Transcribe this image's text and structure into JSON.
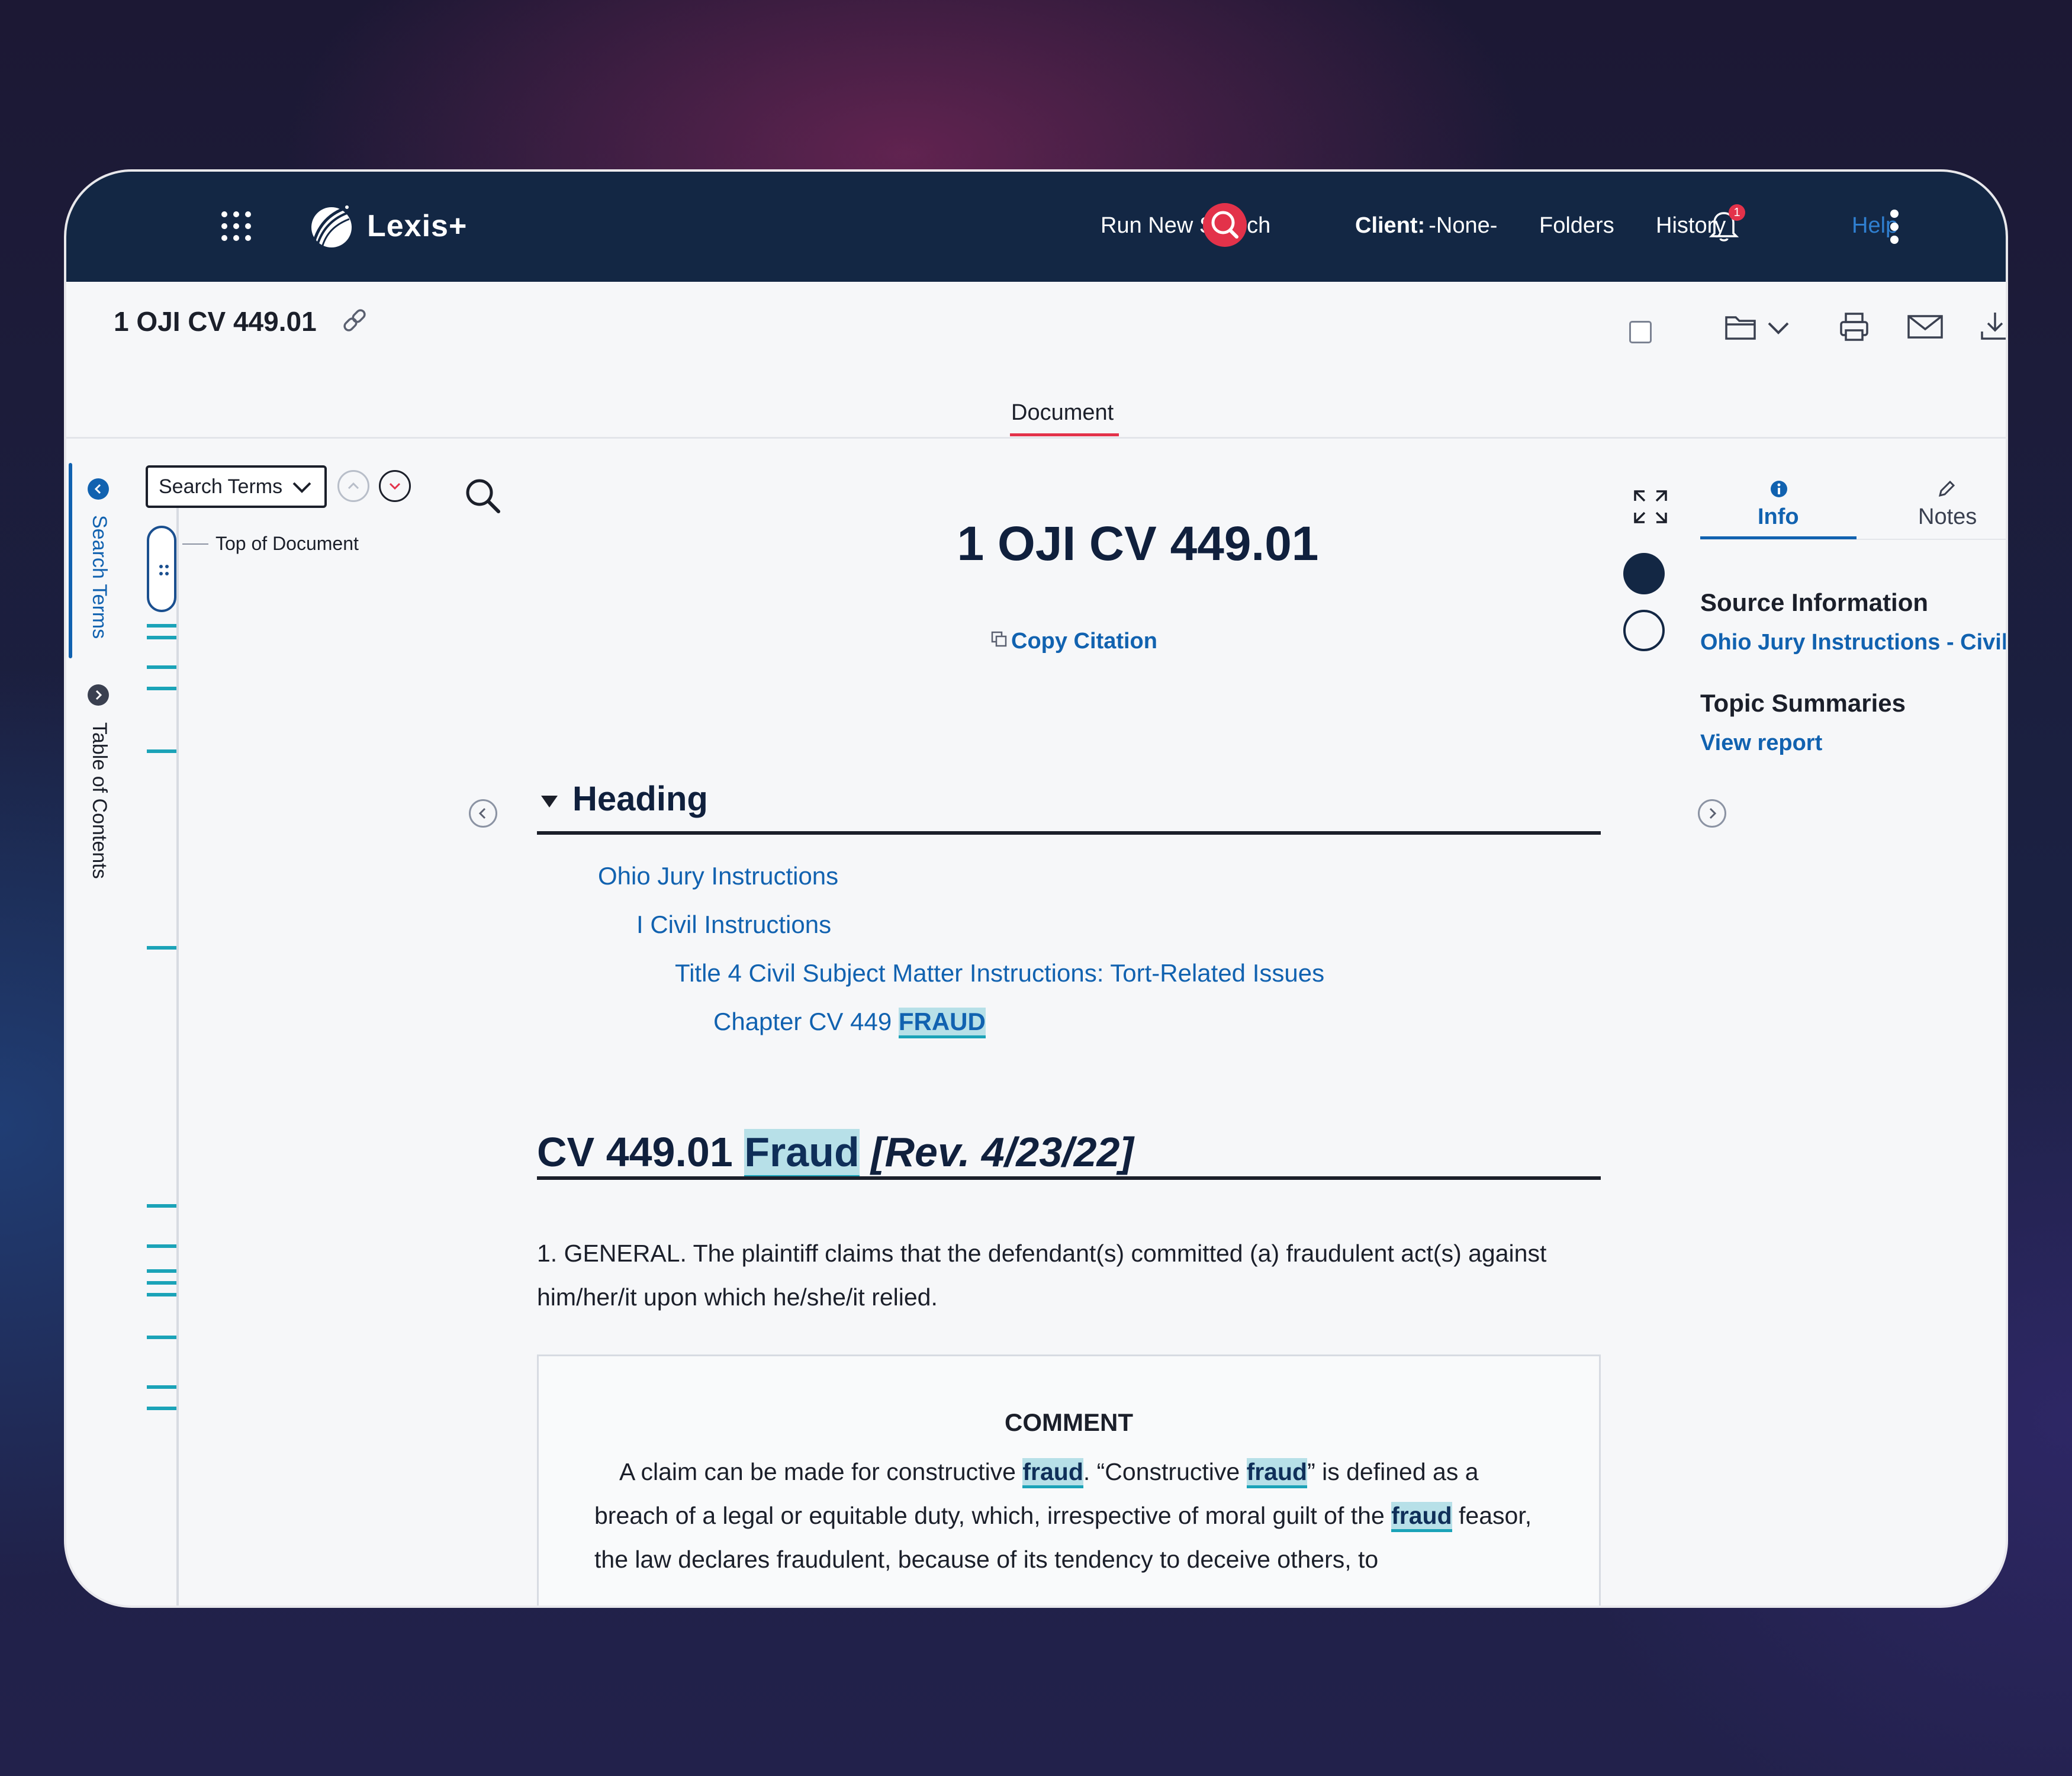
{
  "app": {
    "name": "Lexis+"
  },
  "topbar": {
    "run_new_search": "Run New Search",
    "client_label": "Client:",
    "client_value": "-None-",
    "folders": "Folders",
    "history": "History",
    "notification_count": "1",
    "help": "Help"
  },
  "document_header": {
    "id": "1 OJI CV 449.01",
    "tab_document": "Document"
  },
  "left_panel": {
    "search_terms_tab": "Search Terms",
    "toc_tab": "Table of Contents",
    "search_terms_select": "Search Terms",
    "top_of_document": "Top of Document"
  },
  "document": {
    "title": "1 OJI CV 449.01",
    "copy_citation": "Copy Citation",
    "heading_section": "Heading",
    "breadcrumb": {
      "level1": "Ohio Jury Instructions",
      "level2": "I Civil Instructions",
      "level3": "Title 4 Civil Subject Matter Instructions: Tort-Related Issues",
      "level4_prefix": "Chapter CV 449 ",
      "level4_term": "FRAUD"
    },
    "section_heading": {
      "prefix": "CV 449.01 ",
      "term": "Fraud",
      "suffix": " [Rev. 4/23/22]"
    },
    "paragraph1": "1. GENERAL. The plaintiff claims that the defendant(s) committed (a) fraudulent act(s) against him/her/it upon which he/she/it relied.",
    "comment": {
      "title": "COMMENT",
      "t1": "A claim can be made for constructive ",
      "term1": "fraud",
      "t2": ". “Constructive ",
      "term2": "fraud",
      "t3": "” is defined as a breach of a legal or equitable duty, which, irrespective of moral guilt of the ",
      "term3": "fraud",
      "t4": " feasor, the law declares fraudulent, because of its tendency to deceive others, to"
    }
  },
  "right_panel": {
    "tab_info": "Info",
    "tab_notes": "Notes",
    "source_heading": "Source Information",
    "source_link": "Ohio Jury Instructions - Civil",
    "topic_heading": "Topic Summaries",
    "topic_link": "View report"
  },
  "colors": {
    "navy": "#132744",
    "accent_red": "#e3324a",
    "link_blue": "#1162b0",
    "hit_teal": "#1ba3b8"
  },
  "icons": [
    "apps-grid-icon",
    "lexis-logo-icon",
    "search-icon",
    "notification-bell-icon",
    "more-vertical-icon",
    "link-icon",
    "checkbox-icon",
    "folder-icon",
    "chevron-down-icon",
    "print-icon",
    "email-icon",
    "download-icon",
    "search-in-document-icon",
    "expand-icon",
    "info-icon",
    "pencil-icon",
    "copy-icon",
    "chevron-left-icon",
    "chevron-right-icon",
    "chevron-up-icon"
  ]
}
